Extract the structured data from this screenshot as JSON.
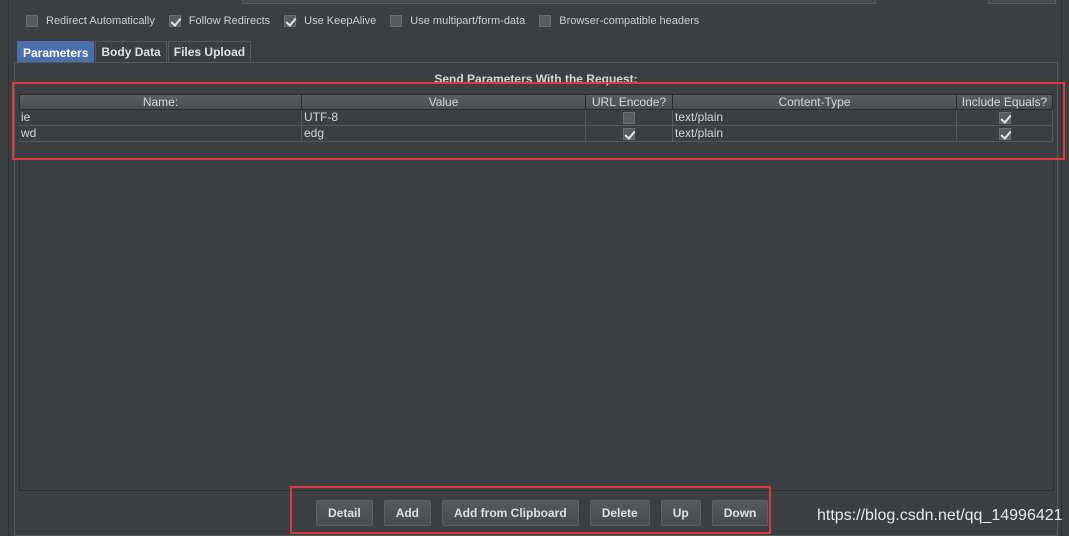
{
  "options": [
    {
      "label": "Redirect Automatically",
      "checked": false
    },
    {
      "label": "Follow Redirects",
      "checked": true
    },
    {
      "label": "Use KeepAlive",
      "checked": true
    },
    {
      "label": "Use multipart/form-data",
      "checked": false
    },
    {
      "label": "Browser-compatible headers",
      "checked": false
    }
  ],
  "tabs": [
    {
      "label": "Parameters",
      "active": true
    },
    {
      "label": "Body Data",
      "active": false
    },
    {
      "label": "Files Upload",
      "active": false
    }
  ],
  "panel": {
    "title": "Send Parameters With the Request:"
  },
  "table": {
    "columns": [
      "Name:",
      "Value",
      "URL Encode?",
      "Content-Type",
      "Include Equals?"
    ],
    "rows": [
      {
        "name": "ie",
        "value": "UTF-8",
        "url_encode": false,
        "content_type": "text/plain",
        "include_equals": true
      },
      {
        "name": "wd",
        "value": "edg",
        "url_encode": true,
        "content_type": "text/plain",
        "include_equals": true
      }
    ]
  },
  "buttons": {
    "detail": "Detail",
    "add": "Add",
    "add_from_clipboard": "Add from Clipboard",
    "delete": "Delete",
    "up": "Up",
    "down": "Down"
  },
  "watermark": "https://blog.csdn.net/qq_14996421",
  "colors": {
    "highlight": "#e0393e",
    "active_tab": "#4b6eaf",
    "background": "#3c3f41"
  }
}
